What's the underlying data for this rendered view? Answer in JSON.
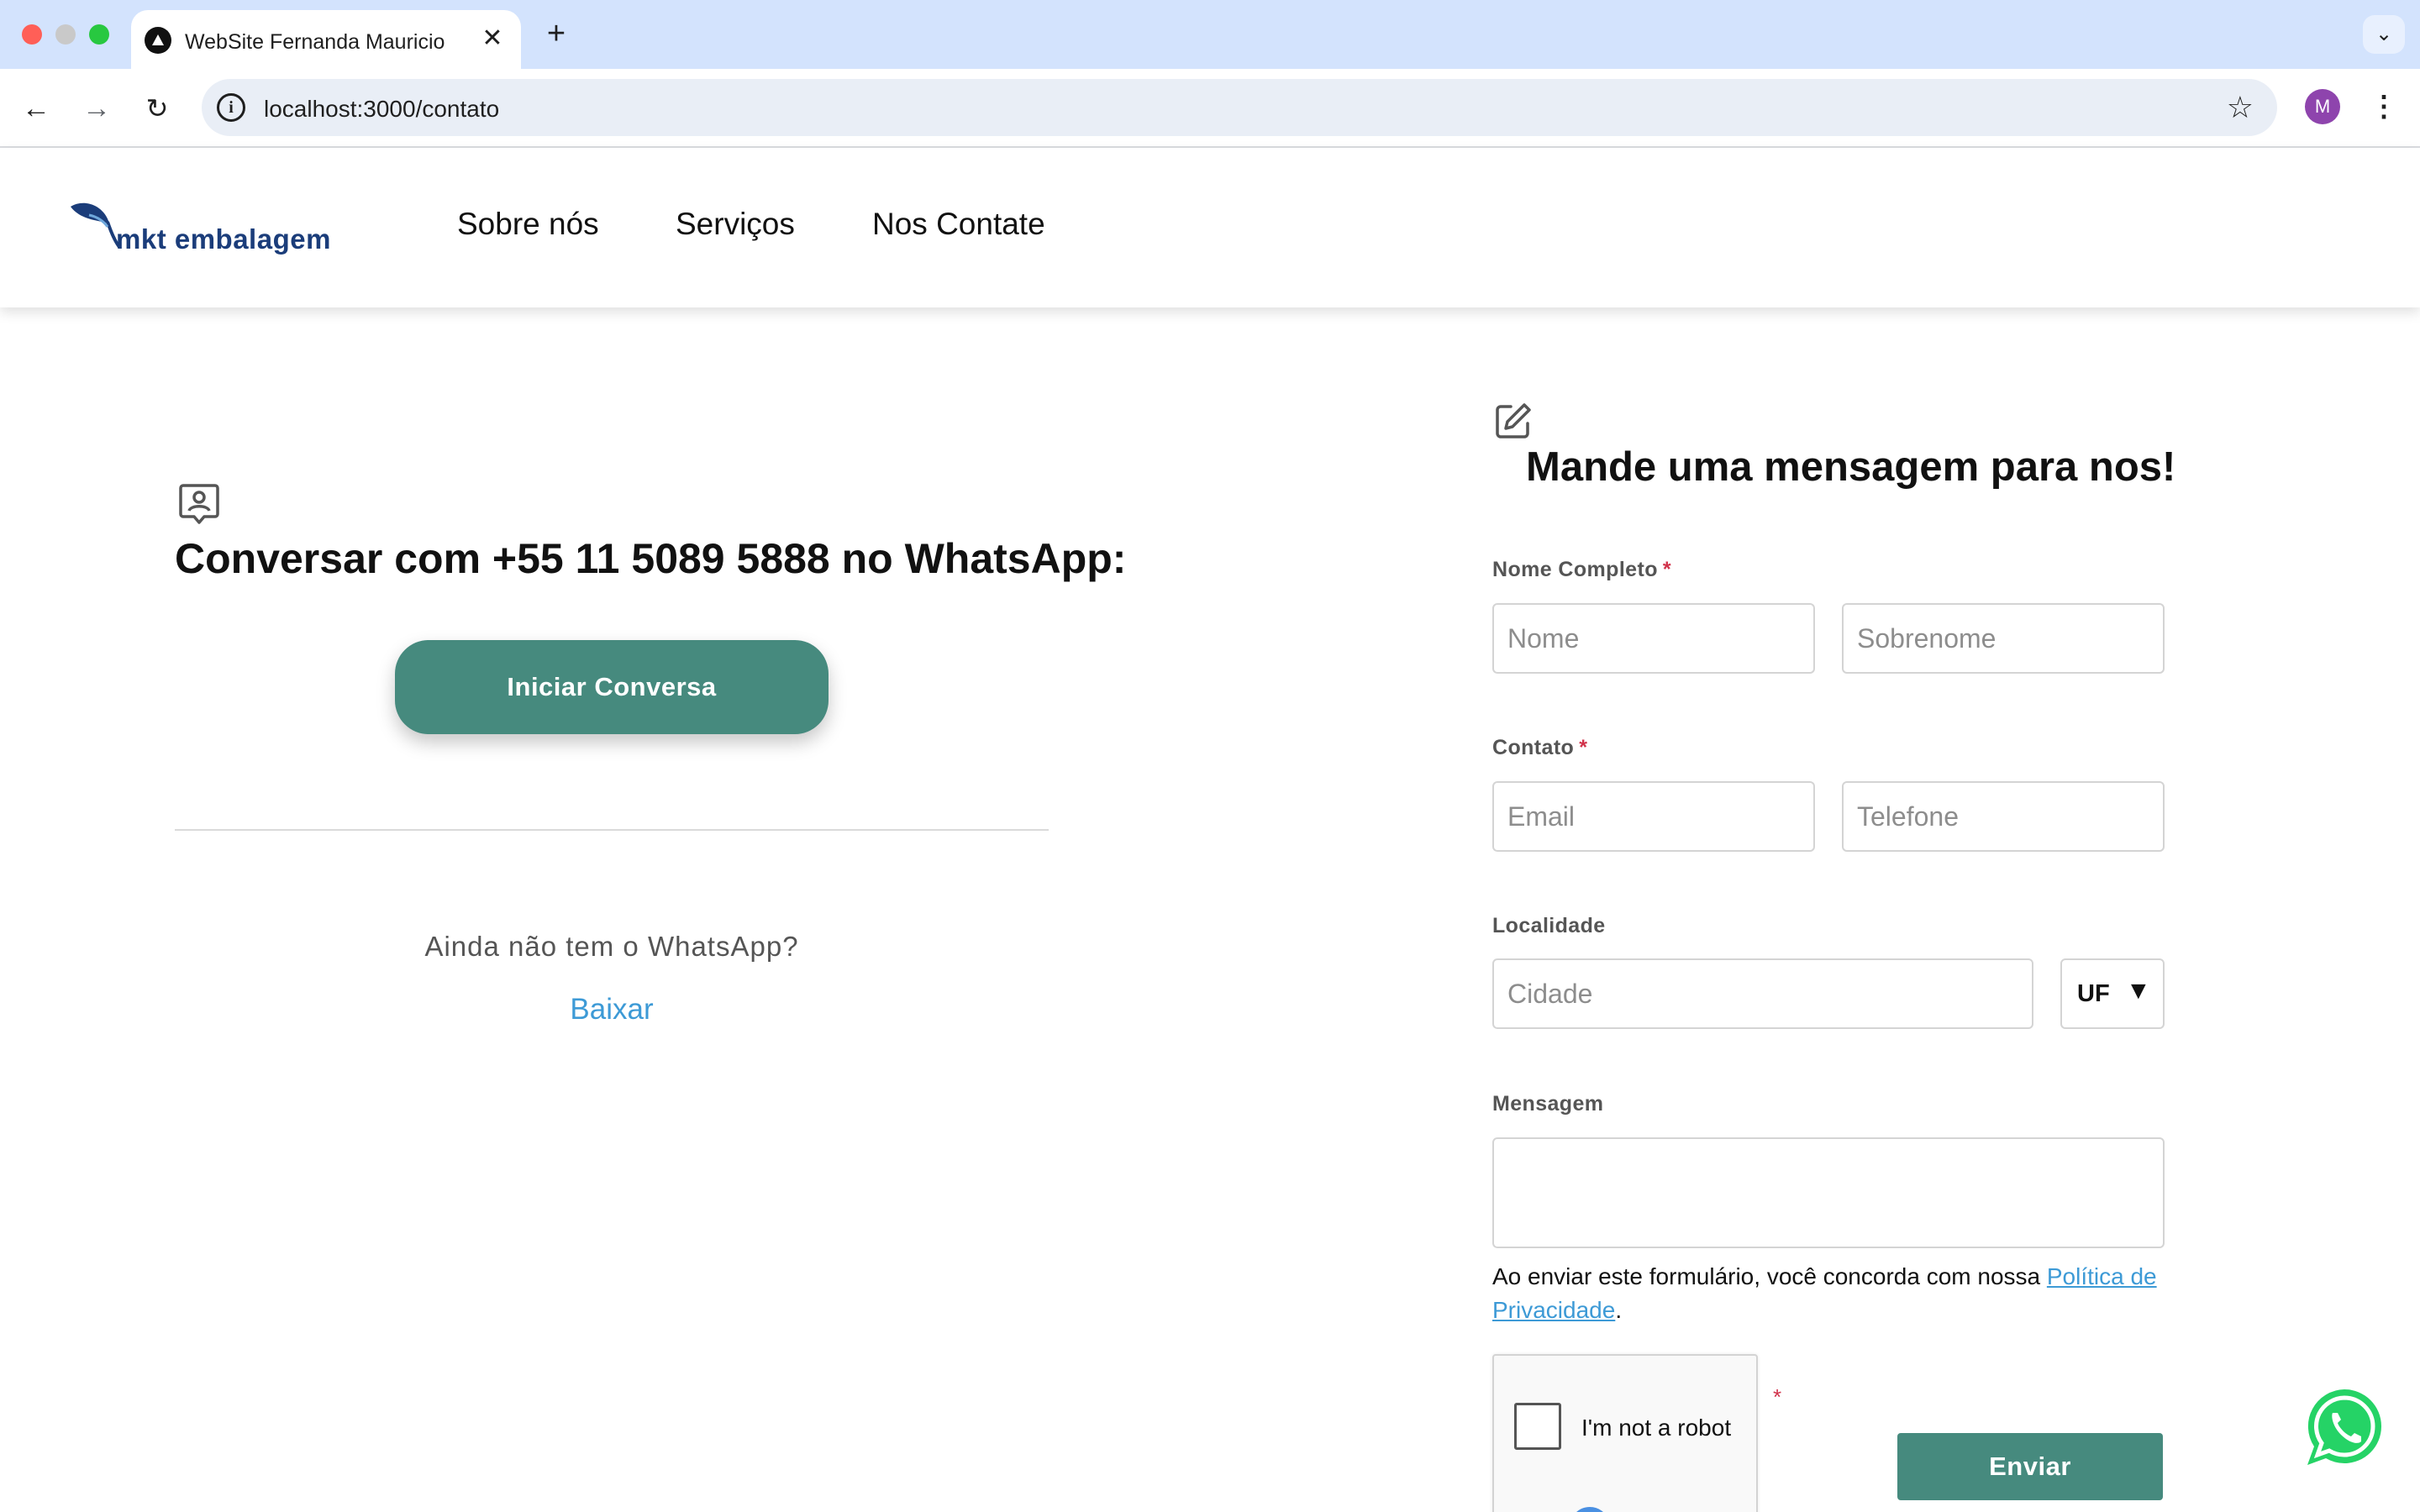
{
  "browser": {
    "tab_title": "WebSite Fernanda Mauricio",
    "tab_close": "✕",
    "new_tab": "+",
    "url": "localhost:3000/contato",
    "profile_initial": "M"
  },
  "header": {
    "logo_text": "mkt embalagem",
    "nav": [
      "Sobre nós",
      "Serviços",
      "Nos Contate"
    ]
  },
  "whatsapp": {
    "heading": "Conversar com +55 11 5089 5888 no WhatsApp:",
    "start_button": "Iniciar Conversa",
    "no_app_text": "Ainda não tem o WhatsApp?",
    "download_link": "Baixar"
  },
  "form": {
    "title": "Mande uma mensagem para nos!",
    "name_label": "Nome Completo",
    "required_mark": "*",
    "first_name_placeholder": "Nome",
    "last_name_placeholder": "Sobrenome",
    "contact_label": "Contato",
    "email_placeholder": "Email",
    "phone_placeholder": "Telefone",
    "location_label": "Localidade",
    "city_placeholder": "Cidade",
    "uf_label": "UF",
    "uf_arrow": "▼",
    "message_label": "Mensagem",
    "consent_text": "Ao enviar este formulário, você concorda com nossa ",
    "privacy_link": "Política de Privacidade",
    "consent_end": ".",
    "captcha_label": "I'm not a robot",
    "send_button": "Enviar"
  },
  "colors": {
    "accent": "#468a7e",
    "link": "#3d9ad6",
    "brand": "#1b3d7a",
    "whatsapp": "#25d366"
  }
}
